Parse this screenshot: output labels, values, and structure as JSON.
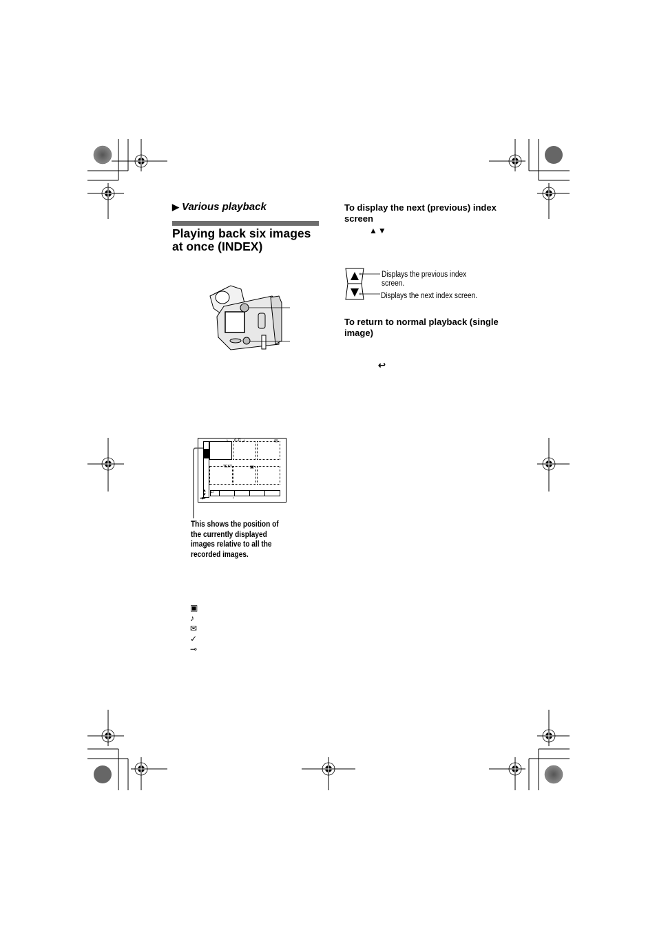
{
  "section": {
    "marker": "▶",
    "label": "Various playback"
  },
  "page_title": "Playing back six images at once (INDEX)",
  "right_column": {
    "next_prev_heading": "To display the next (previous) index screen",
    "arrow_glyphs": "▲▼",
    "up_button_desc": "Displays the previous index screen.",
    "down_button_desc": "Displays the next index screen.",
    "return_heading": "To return to normal playback (single image)",
    "return_icon": "return-icon"
  },
  "index_screen": {
    "text_label": "TEXT",
    "position_caption": "This shows the position of the currently displayed images relative to all the recorded images."
  },
  "icon_legend": [
    {
      "name": "movie-icon"
    },
    {
      "name": "audio-icon"
    },
    {
      "name": "email-icon"
    },
    {
      "name": "print-mark-icon"
    },
    {
      "name": "protect-key-icon"
    }
  ]
}
